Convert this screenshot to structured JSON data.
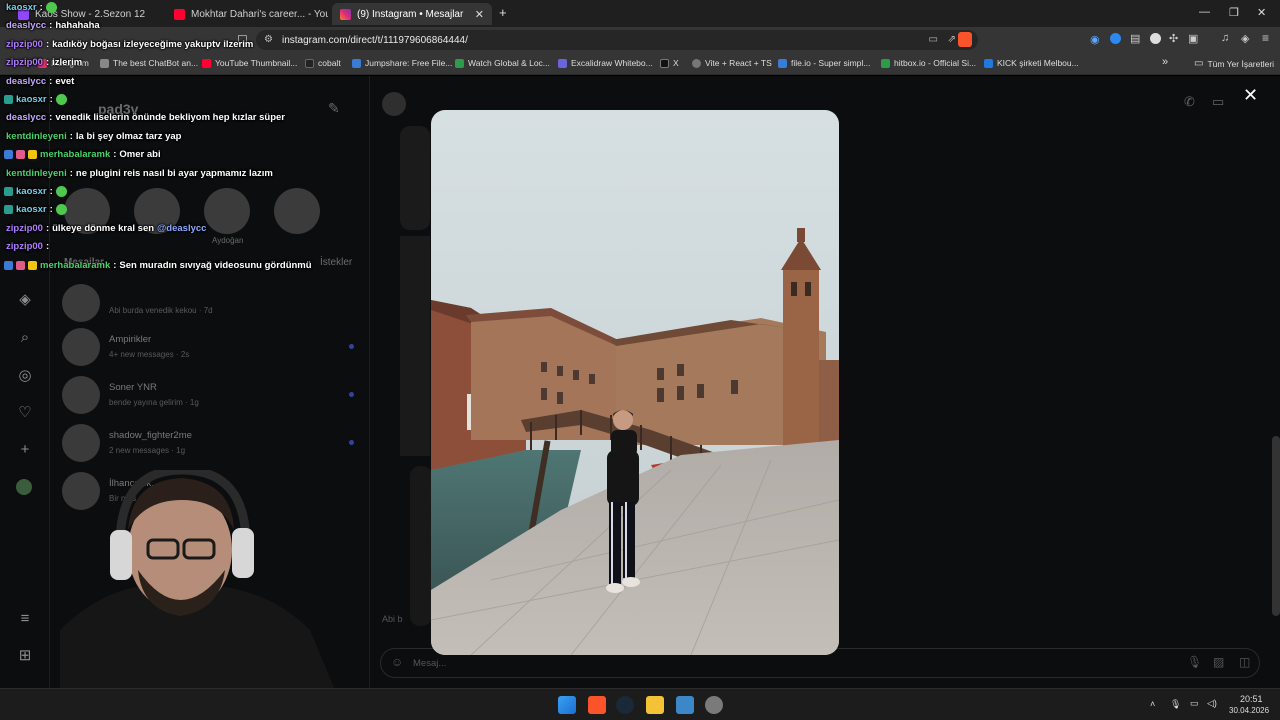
{
  "browser": {
    "tabs": [
      {
        "title": "Kaos Show - 2.Sezon 12",
        "color": "#9146ff"
      },
      {
        "title": "Mokhtar Dahari's career... - YouTube",
        "color": "#ff0033"
      },
      {
        "title": "(9) Instagram • Mesajlar",
        "color": "#e1306c",
        "active": true
      }
    ],
    "new_tab": "+",
    "url": "instagram.com/direct/t/111979606864444/",
    "bookmarks": [
      {
        "label": "Instagram",
        "color": "#e1306c"
      },
      {
        "label": "The best ChatBot an...",
        "color": "#888888"
      },
      {
        "label": "YouTube Thumbnail...",
        "color": "#ff0033"
      },
      {
        "label": "cobalt",
        "color": "#222222"
      },
      {
        "label": "Jumpshare: Free File...",
        "color": "#3a7bd5"
      },
      {
        "label": "Watch Global & Loc...",
        "color": "#2d9c4a"
      },
      {
        "label": "Excalidraw Whitebo...",
        "color": "#6965db"
      },
      {
        "label": "X",
        "color": "#111111"
      },
      {
        "label": "Vite + React + TS",
        "color": "#777777"
      },
      {
        "label": "file.io - Super simpl...",
        "color": "#3a7bd5"
      },
      {
        "label": "hitbox.io - Official Si...",
        "color": "#2d9c4a"
      },
      {
        "label": "KICK şirketi Melbou...",
        "color": "#1f7ae0"
      }
    ],
    "bookmarks_more": "»",
    "all_bookmarks": "Tüm Yer İşaretleri"
  },
  "instagram": {
    "username": "pad3v",
    "story_labels": [
      "Aydoğan"
    ],
    "tab_messages": "Mesajlar",
    "tab_requests": "İstekler",
    "conversations": [
      {
        "name": "",
        "sub": "Abi burda venedik kekou · 7d"
      },
      {
        "name": "Ampirikler",
        "sub": "4+ new messages · 2s"
      },
      {
        "name": "Soner YNR",
        "sub": "bende yayına gelirim · 1g"
      },
      {
        "name": "shadow_fighter2me",
        "sub": "2 new messages · 1g"
      },
      {
        "name": "İlhancalsk...",
        "sub": "Bir mes..."
      }
    ],
    "composer_placeholder": "Mesaj...",
    "thread_preview": "Abi b"
  },
  "modal": {
    "close": "✕"
  },
  "chat": [
    {
      "user": "kaosxr",
      "color": "#66d3f3",
      "text": "",
      "emote": true,
      "badges": []
    },
    {
      "user": "deaslycc",
      "color": "#c4a8ff",
      "text": "hahahaha",
      "badges": []
    },
    {
      "user": "zipzip00",
      "color": "#b07cff",
      "text": "kadıköy boğası izleyeceğime yakuptv ilzerim",
      "badges": []
    },
    {
      "user": "zipzip00",
      "color": "#b07cff",
      "text": "izlerim",
      "badges": []
    },
    {
      "user": "deaslycc",
      "color": "#c4a8ff",
      "text": "evet",
      "badges": []
    },
    {
      "user": "kaosxr",
      "color": "#66d3f3",
      "text": "",
      "emote": true,
      "badges": [
        "#2a9d8f"
      ]
    },
    {
      "user": "deaslycc",
      "color": "#c4a8ff",
      "text": "venedik liselerin önünde bekliyom hep kızlar süper",
      "badges": []
    },
    {
      "user": "kentdinleyeni",
      "color": "#49d26a",
      "text": "la bi şey olmaz tarz yap",
      "badges": []
    },
    {
      "user": "merhabalaramk",
      "color": "#49d26a",
      "text": "Omer abi",
      "badges": [
        "#3a7bd5",
        "#e05a8a",
        "#f1c40f"
      ]
    },
    {
      "user": "kentdinleyeni",
      "color": "#49d26a",
      "text": "ne plugini reis nasıl bi ayar yapmamız lazım",
      "badges": []
    },
    {
      "user": "kaosxr",
      "color": "#66d3f3",
      "text": "",
      "emote": true,
      "badges": [
        "#2a9d8f"
      ]
    },
    {
      "user": "kaosxr",
      "color": "#66d3f3",
      "text": "",
      "emote": true,
      "badges": [
        "#2a9d8f"
      ]
    },
    {
      "user": "zipzip00",
      "color": "#b07cff",
      "text": "ülkeye dönme kral sen",
      "mention": "@deaslycc",
      "badges": []
    },
    {
      "user": "zipzip00",
      "color": "#b07cff",
      "text": "",
      "badges": []
    },
    {
      "user": "merhabalaramk",
      "color": "#49d26a",
      "text": "Sen muradın sıvıyağ videosunu gördünmü",
      "badges": [
        "#3a7bd5",
        "#e05a8a",
        "#f1c40f"
      ]
    }
  ],
  "taskbar": {
    "time": "20:51",
    "date": "30.04.2026"
  }
}
